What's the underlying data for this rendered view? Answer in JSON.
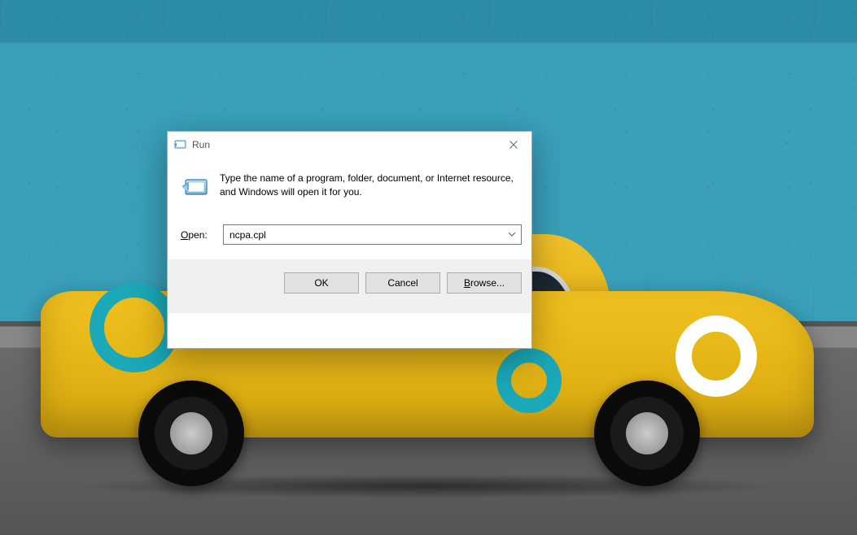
{
  "dialog": {
    "title": "Run",
    "description": "Type the name of a program, folder, document, or Internet resource, and Windows will open it for you.",
    "open_label_prefix": "O",
    "open_label_rest": "pen:",
    "input_value": "ncpa.cpl",
    "buttons": {
      "ok": "OK",
      "cancel": "Cancel",
      "browse_accel": "B",
      "browse_rest": "rowse..."
    }
  }
}
